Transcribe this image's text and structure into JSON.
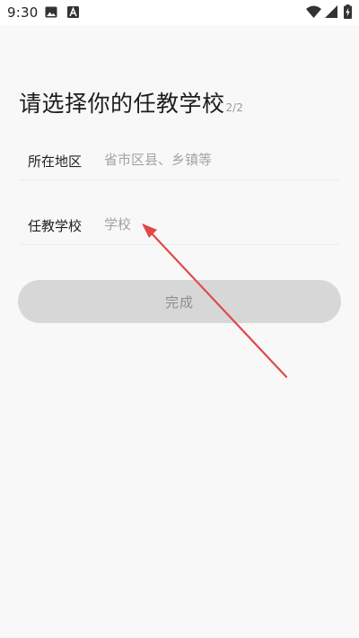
{
  "status_bar": {
    "time": "9:30",
    "icons": [
      "image-icon",
      "a-letter-icon",
      "wifi-icon",
      "signal-icon",
      "battery-charging-icon"
    ]
  },
  "page": {
    "title": "请选择你的任教学校",
    "step": "2/2"
  },
  "form": {
    "region": {
      "label": "所在地区",
      "placeholder": "省市区县、乡镇等",
      "value": ""
    },
    "school": {
      "label": "任教学校",
      "placeholder": "学校",
      "value": ""
    }
  },
  "done_button": {
    "label": "完成",
    "enabled": false
  },
  "colors": {
    "background": "#f9f8f8",
    "button_disabled": "#d7d7d7",
    "annotation_arrow": "#e04848"
  }
}
